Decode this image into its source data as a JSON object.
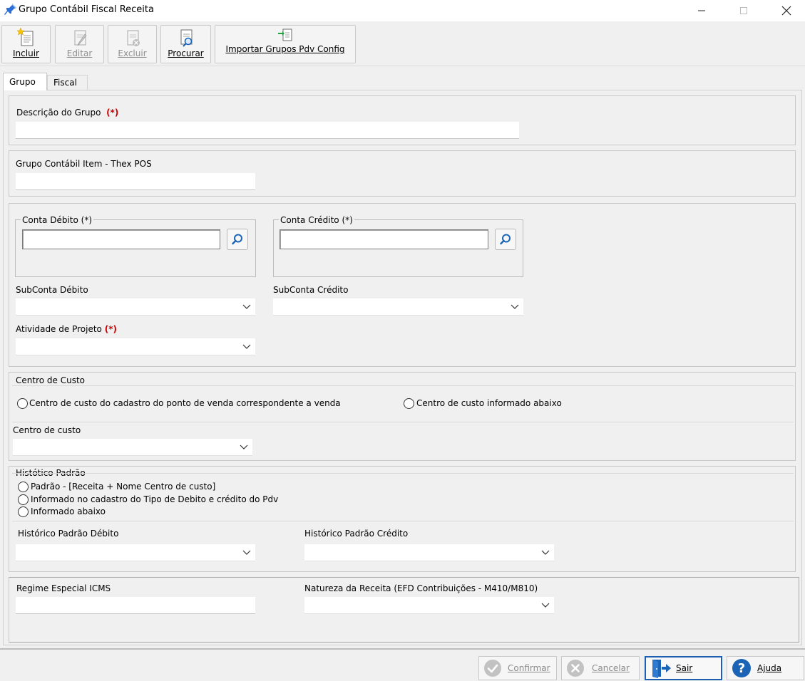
{
  "window": {
    "title": "Grupo Contábil Fiscal Receita"
  },
  "toolbar": {
    "incluir": {
      "label": "Incluir"
    },
    "editar": {
      "label": "Editar"
    },
    "excluir": {
      "label": "Excluir"
    },
    "procurar": {
      "label": "Procurar"
    },
    "importar": {
      "label": "Importar Grupos Pdv Config"
    }
  },
  "tabs": [
    {
      "label": "Grupo"
    },
    {
      "label": "Fiscal"
    }
  ],
  "form": {
    "descricao": {
      "label": "Descrição do Grupo",
      "required": "(*)",
      "value": ""
    },
    "grupo_item": {
      "label": "Grupo Contábil Item - Thex POS",
      "value": ""
    },
    "conta_debito": {
      "label": "Conta Débito (*)",
      "value": ""
    },
    "conta_credito": {
      "label": "Conta Crédito (*)",
      "value": ""
    },
    "subconta_debito": {
      "label": "SubConta Débito",
      "value": ""
    },
    "subconta_credito": {
      "label": "SubConta Crédito",
      "value": ""
    },
    "atividade": {
      "label": "Atividade de Projeto",
      "required": "(*)",
      "value": ""
    },
    "centro_custo_group": {
      "legend": "Centro de Custo",
      "option1": "Centro de custo do cadastro do ponto de venda correspondente a venda",
      "option2": "Centro de custo informado abaixo"
    },
    "centro_custo": {
      "label": "Centro de custo",
      "value": ""
    },
    "historico_group": {
      "legend": "Histótico Padrão",
      "option1": "Padrão - [Receita + Nome Centro de custo]",
      "option2": "Informado no cadastro do Tipo de Debito e crédito do Pdv",
      "option3": "Informado abaixo"
    },
    "historico_debito": {
      "label": "Histórico Padrão Débito",
      "value": ""
    },
    "historico_credito": {
      "label": "Histórico Padrão Crédito",
      "value": ""
    },
    "regime_icms": {
      "label": "Regime Especial ICMS",
      "value": ""
    },
    "natureza_receita": {
      "label": "Natureza da Receita (EFD Contribuições - M410/M810)",
      "value": ""
    }
  },
  "footer": {
    "confirmar": "Confirmar",
    "cancelar": "Cancelar",
    "sair": "Sair",
    "ajuda": "Ajuda"
  },
  "colors": {
    "required": "#d00000",
    "focus_border": "#1c5fb0",
    "icon_blue": "#1b63b4",
    "disabled_gray": "#9e9e9e"
  }
}
